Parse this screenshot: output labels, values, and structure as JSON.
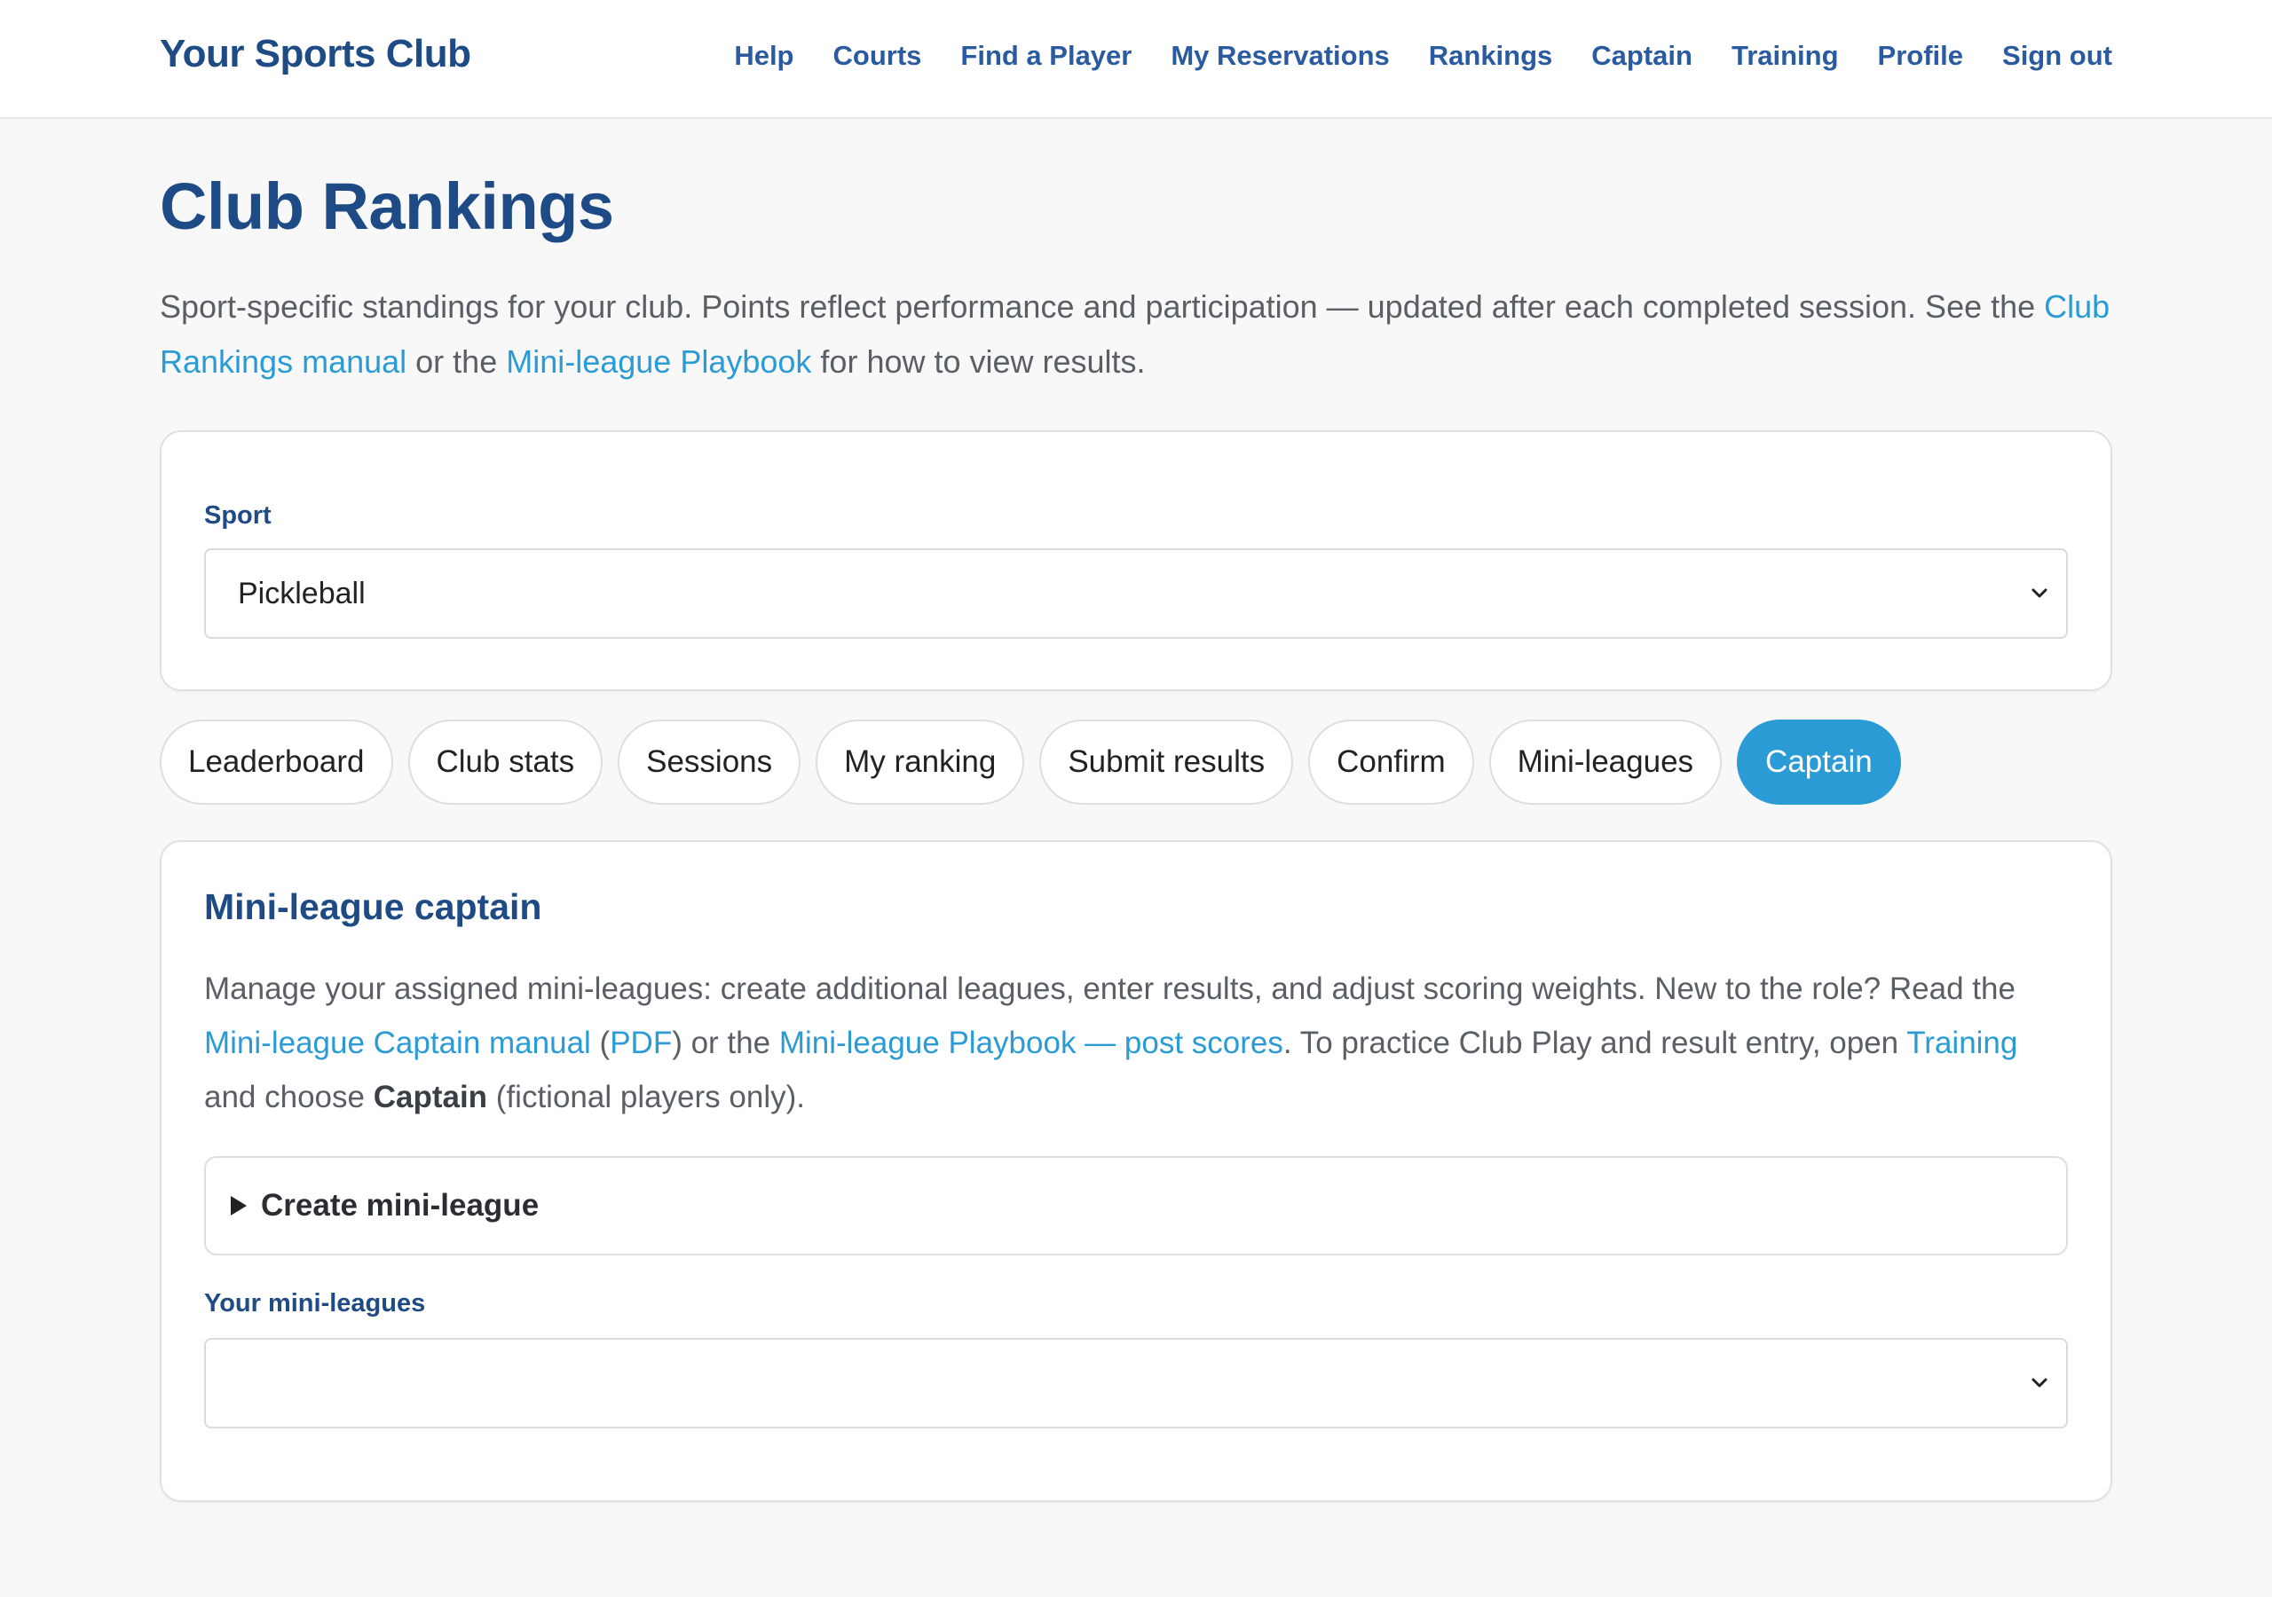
{
  "header": {
    "brand": "Your Sports Club",
    "nav": [
      "Help",
      "Courts",
      "Find a Player",
      "My Reservations",
      "Rankings",
      "Captain",
      "Training",
      "Profile",
      "Sign out"
    ]
  },
  "page": {
    "title": "Club Rankings",
    "intro": {
      "text1": "Sport-specific standings for your club. Points reflect performance and participation — updated after each completed session. See the ",
      "link1": "Club Rankings manual",
      "text2": " or the ",
      "link2": "Mini-league Playbook",
      "text3": " for how to view results."
    }
  },
  "sport": {
    "label": "Sport",
    "selected": "Pickleball"
  },
  "tabs": [
    {
      "label": "Leaderboard",
      "active": false
    },
    {
      "label": "Club stats",
      "active": false
    },
    {
      "label": "Sessions",
      "active": false
    },
    {
      "label": "My ranking",
      "active": false
    },
    {
      "label": "Submit results",
      "active": false
    },
    {
      "label": "Confirm",
      "active": false
    },
    {
      "label": "Mini-leagues",
      "active": false
    },
    {
      "label": "Captain",
      "active": true
    }
  ],
  "captain": {
    "title": "Mini-league captain",
    "desc": {
      "t1": "Manage your assigned mini-leagues: create additional leagues, enter results, and adjust scoring weights. New to the role? Read the ",
      "l1": "Mini-league Captain manual",
      "t2": " (",
      "l2": "PDF",
      "t3": ") or the ",
      "l3": "Mini-league Playbook — post scores",
      "t4": ". To practice Club Play and result entry, open ",
      "l4": "Training",
      "t5": " and choose ",
      "b1": "Captain",
      "t6": " (fictional players only)."
    },
    "create_label": "Create mini-league",
    "leagues_label": "Your mini-leagues",
    "leagues_selected": ""
  },
  "colors": {
    "brand": "#1e4a85",
    "link": "#2b9bd6",
    "active_tab": "#2b9bd6",
    "background": "#f8f8f8"
  },
  "icons": {
    "select_arrow": "chevron-down-icon",
    "disclosure": "disclosure-triangle-icon"
  }
}
